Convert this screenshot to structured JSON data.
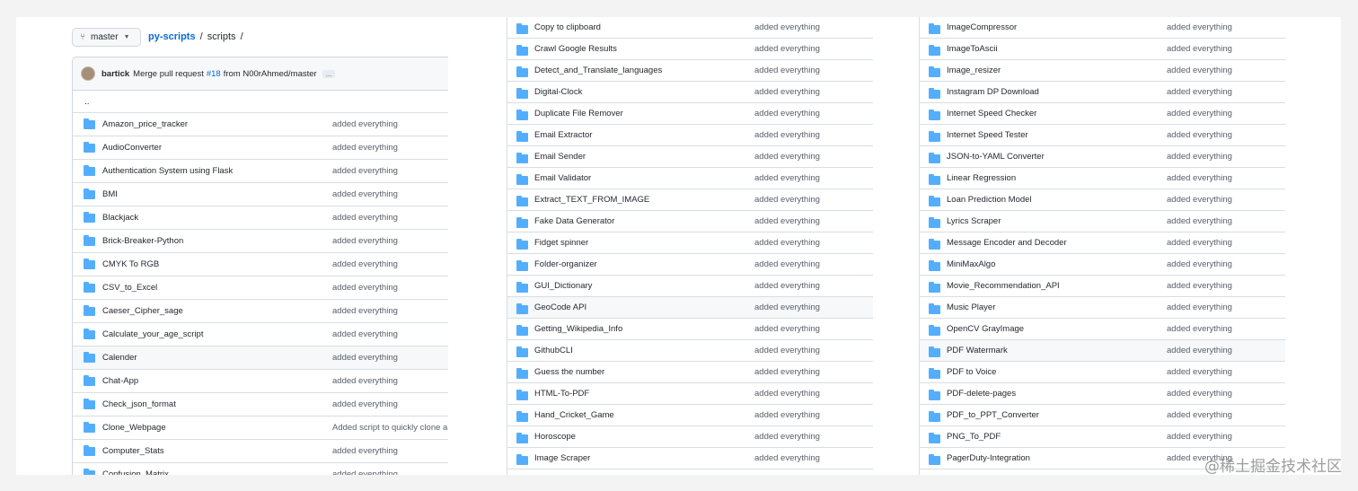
{
  "branch": {
    "label": "master",
    "icon": "git-branch-icon"
  },
  "breadcrumb": {
    "repo": "py-scripts",
    "sep1": "/",
    "folder": "scripts",
    "sep2": "/"
  },
  "commit": {
    "author": "bartick",
    "message_pre": "Merge pull request",
    "pr": "#18",
    "message_post": "from N00rAhmed/master",
    "ellipsis": "..."
  },
  "parent": "..",
  "left_rows": [
    {
      "name": "Amazon_price_tracker",
      "msg": "added everything"
    },
    {
      "name": "AudioConverter",
      "msg": "added everything"
    },
    {
      "name": "Authentication System using Flask",
      "msg": "added everything"
    },
    {
      "name": "BMI",
      "msg": "added everything"
    },
    {
      "name": "Blackjack",
      "msg": "added everything"
    },
    {
      "name": "Brick-Breaker-Python",
      "msg": "added everything"
    },
    {
      "name": "CMYK To RGB",
      "msg": "added everything"
    },
    {
      "name": "CSV_to_Excel",
      "msg": "added everything"
    },
    {
      "name": "Caeser_Cipher_sage",
      "msg": "added everything"
    },
    {
      "name": "Calculate_your_age_script",
      "msg": "added everything"
    },
    {
      "name": "Calender",
      "msg": "added everything"
    },
    {
      "name": "Chat-App",
      "msg": "added everything"
    },
    {
      "name": "Check_json_format",
      "msg": "added everything"
    },
    {
      "name": "Clone_Webpage",
      "msg": "Added script to quickly clone a"
    },
    {
      "name": "Computer_Stats",
      "msg": "added everything"
    },
    {
      "name": "Confusion_Matrix",
      "msg": "added everything"
    }
  ],
  "mid_rows": [
    {
      "name": "Copy to clipboard",
      "msg": "added everything"
    },
    {
      "name": "Crawl Google Results",
      "msg": "added everything"
    },
    {
      "name": "Detect_and_Translate_languages",
      "msg": "added everything"
    },
    {
      "name": "Digital-Clock",
      "msg": "added everything"
    },
    {
      "name": "Duplicate File Remover",
      "msg": "added everything"
    },
    {
      "name": "Email Extractor",
      "msg": "added everything"
    },
    {
      "name": "Email Sender",
      "msg": "added everything"
    },
    {
      "name": "Email Validator",
      "msg": "added everything"
    },
    {
      "name": "Extract_TEXT_FROM_IMAGE",
      "msg": "added everything"
    },
    {
      "name": "Fake Data Generator",
      "msg": "added everything"
    },
    {
      "name": "Fidget spinner",
      "msg": "added everything"
    },
    {
      "name": "Folder-organizer",
      "msg": "added everything"
    },
    {
      "name": "GUI_Dictionary",
      "msg": "added everything"
    },
    {
      "name": "GeoCode API",
      "msg": "added everything"
    },
    {
      "name": "Getting_Wikipedia_Info",
      "msg": "added everything"
    },
    {
      "name": "GithubCLI",
      "msg": "added everything"
    },
    {
      "name": "Guess the number",
      "msg": "added everything"
    },
    {
      "name": "HTML-To-PDF",
      "msg": "added everything"
    },
    {
      "name": "Hand_Cricket_Game",
      "msg": "added everything"
    },
    {
      "name": "Horoscope",
      "msg": "added everything"
    },
    {
      "name": "Image Scraper",
      "msg": "added everything"
    }
  ],
  "right_rows": [
    {
      "name": "ImageCompressor",
      "msg": "added everything"
    },
    {
      "name": "ImageToAscii",
      "msg": "added everything"
    },
    {
      "name": "Image_resizer",
      "msg": "added everything"
    },
    {
      "name": "Instagram DP Download",
      "msg": "added everything"
    },
    {
      "name": "Internet Speed Checker",
      "msg": "added everything"
    },
    {
      "name": "Internet Speed Tester",
      "msg": "added everything"
    },
    {
      "name": "JSON-to-YAML Converter",
      "msg": "added everything"
    },
    {
      "name": "Linear Regression",
      "msg": "added everything"
    },
    {
      "name": "Loan Prediction Model",
      "msg": "added everything"
    },
    {
      "name": "Lyrics Scraper",
      "msg": "added everything"
    },
    {
      "name": "Message Encoder and Decoder",
      "msg": "added everything"
    },
    {
      "name": "MiniMaxAlgo",
      "msg": "added everything"
    },
    {
      "name": "Movie_Recommendation_API",
      "msg": "added everything"
    },
    {
      "name": "Music Player",
      "msg": "added everything"
    },
    {
      "name": "OpenCV GrayImage",
      "msg": "added everything"
    },
    {
      "name": "PDF Watermark",
      "msg": "added everything"
    },
    {
      "name": "PDF to Voice",
      "msg": "added everything"
    },
    {
      "name": "PDF-delete-pages",
      "msg": "added everything"
    },
    {
      "name": "PDF_to_PPT_Converter",
      "msg": "added everything"
    },
    {
      "name": "PNG_To_PDF",
      "msg": "added everything"
    },
    {
      "name": "PagerDuty-Integration",
      "msg": "added everything"
    }
  ],
  "watermark": "@稀土掘金技术社区",
  "colors": {
    "folder": "#54aeff",
    "link": "#0969da",
    "border": "#d8dee4"
  }
}
